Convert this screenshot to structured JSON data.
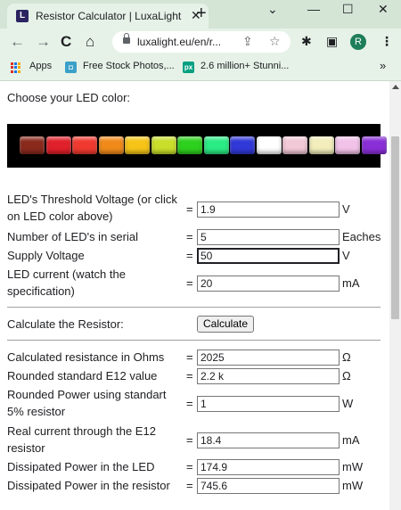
{
  "browser": {
    "tab_title": "Resistor Calculator | LuxaLight",
    "favicon_letter": "L",
    "url": "luxalight.eu/en/r...",
    "profile_initial": "R",
    "bookmarks": [
      {
        "label": "Apps"
      },
      {
        "label": "Free Stock Photos,..."
      },
      {
        "label": "2.6 million+ Stunni...",
        "badge": "px"
      }
    ],
    "more_bookmarks": "»"
  },
  "page": {
    "choose_color_label": "Choose your LED color:",
    "led_colors": [
      "#8a2a1c",
      "#e0202a",
      "#f03a30",
      "#f08a1a",
      "#f5c417",
      "#c8de2a",
      "#2ed01e",
      "#2aeb84",
      "#3038d8",
      "#ffffff",
      "#f2c9d6",
      "#f2edbb",
      "#f2c2e8",
      "#8a2ed8"
    ],
    "inputs": [
      {
        "label": "LED's Threshold Voltage (or click on LED color above)",
        "value": "1.9",
        "unit": "V"
      },
      {
        "label": "Number of LED's in serial",
        "value": "5",
        "unit": "Eaches"
      },
      {
        "label": "Supply Voltage",
        "value": "50",
        "unit": "V"
      },
      {
        "label": "LED current (watch the specification)",
        "value": "20",
        "unit": "mA"
      }
    ],
    "calculate_label": "Calculate the Resistor:",
    "calculate_button": "Calculate",
    "results": [
      {
        "label": "Calculated resistance in Ohms",
        "value": "2025",
        "unit": "Ω"
      },
      {
        "label": "Rounded standard E12 value",
        "value": "2.2 k",
        "unit": "Ω"
      },
      {
        "label": "Rounded Power using standart 5% resistor",
        "value": "1",
        "unit": "W"
      },
      {
        "label": "Real current through the E12 resistor",
        "value": "18.4",
        "unit": "mA"
      },
      {
        "label": "Dissipated Power in the LED",
        "value": "174.9",
        "unit": "mW"
      },
      {
        "label": "Dissipated Power in the resistor",
        "value": "745.6",
        "unit": "mW"
      }
    ],
    "equals": "="
  }
}
